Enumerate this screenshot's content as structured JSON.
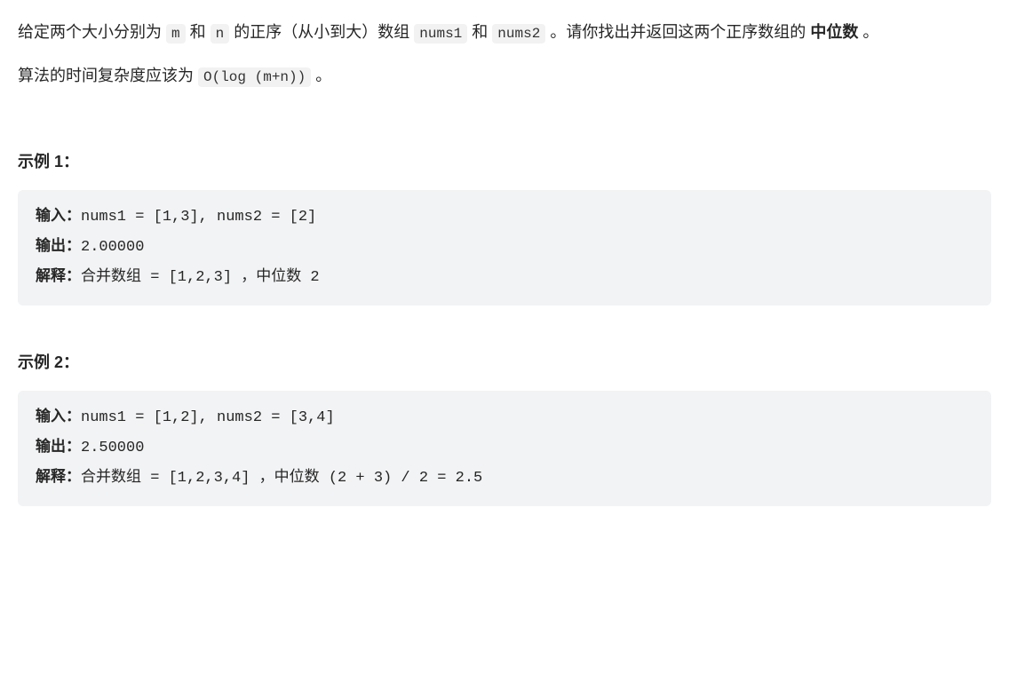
{
  "paragraph1": {
    "t1": "给定两个大小分别为 ",
    "c1": "m",
    "t2": " 和 ",
    "c2": "n",
    "t3": " 的正序（从小到大）数组 ",
    "c3": "nums1",
    "t4": " 和 ",
    "c4": "nums2",
    "t5": " 。请你找出并返回这两个正序数组的 ",
    "bold": "中位数",
    "t6": " 。"
  },
  "paragraph2": {
    "t1": "算法的时间复杂度应该为 ",
    "c1": "O(log (m+n))",
    "t2": " 。"
  },
  "example1": {
    "heading": "示例 1：",
    "labels": {
      "input": "输入：",
      "output": "输出：",
      "explain": "解释："
    },
    "input": "nums1 = [1,3], nums2 = [2]",
    "output": "2.00000",
    "explain": "合并数组 = [1,2,3] ，中位数 2"
  },
  "example2": {
    "heading": "示例 2：",
    "labels": {
      "input": "输入：",
      "output": "输出：",
      "explain": "解释："
    },
    "input": "nums1 = [1,2], nums2 = [3,4]",
    "output": "2.50000",
    "explain": "合并数组 = [1,2,3,4] ，中位数 (2 + 3) / 2 = 2.5"
  }
}
